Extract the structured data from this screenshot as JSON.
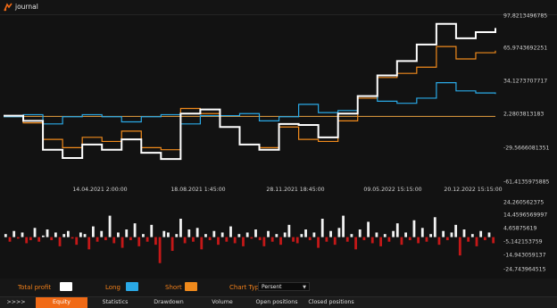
{
  "window": {
    "title": "journal"
  },
  "chart": {
    "y_labels_top": [
      "97,8213496785",
      "65,9743692251",
      "34,1273707717",
      "2,2803813183",
      "-29,5666081351",
      "-61,4135975885"
    ],
    "x_labels": [
      "14.04.2021 2:00:00",
      "18.08.2021 1:45:00",
      "28.11.2021 18:45:00",
      "09.05.2022 15:15:00",
      "20.12.2022 15:15:00"
    ],
    "y_labels_bottom": [
      "24,260562375",
      "14,4596569997",
      "4,65875619",
      "-5,142153759",
      "-14,943059137",
      "-24,743964515"
    ],
    "colors": {
      "total": "#ffffff",
      "long": "#2aa9e6",
      "short": "#f08a1c",
      "zero_line": "#e8a040",
      "bar_pos": "#f2f2f2",
      "bar_neg": "#c41818"
    }
  },
  "chart_data": [
    {
      "type": "line",
      "title": "",
      "ylim": [
        -61.4135975885,
        97.8213496785
      ],
      "x_ticks": [
        "14.04.2021 2:00:00",
        "18.08.2021 1:45:00",
        "28.11.2021 18:45:00",
        "09.05.2022 15:15:00",
        "20.12.2022 15:15:00"
      ],
      "reference_line": 2.2803813183,
      "x": [
        0,
        4,
        8,
        12,
        16,
        20,
        24,
        28,
        32,
        36,
        40,
        44,
        48,
        52,
        56,
        60,
        64,
        68,
        72,
        76,
        80,
        84,
        88,
        92,
        96,
        100
      ],
      "series": [
        {
          "name": "Total profit",
          "values": [
            3,
            -2,
            -30,
            -38,
            -25,
            -30,
            -20,
            -33,
            -39,
            5,
            9,
            -8,
            -25,
            -30,
            -5,
            -6,
            -18,
            5,
            22,
            42,
            56,
            72,
            92,
            78,
            84,
            88
          ]
        },
        {
          "name": "Long",
          "values": [
            2,
            4,
            -5,
            2,
            4,
            2,
            -3,
            2,
            4,
            -5,
            3,
            3,
            5,
            -2,
            2,
            14,
            6,
            8,
            22,
            17,
            15,
            20,
            35,
            27,
            25,
            24
          ]
        },
        {
          "name": "Short",
          "values": [
            2,
            -4,
            -20,
            -28,
            -18,
            -22,
            -12,
            -28,
            -30,
            10,
            5,
            -8,
            -25,
            -28,
            -8,
            -20,
            -22,
            -2,
            20,
            40,
            44,
            50,
            70,
            58,
            64,
            66
          ]
        }
      ]
    },
    {
      "type": "bar",
      "ylim": [
        -24.743964515,
        24.260562375
      ],
      "series": [
        {
          "values": [
            2,
            -3,
            4,
            -1,
            3,
            -4,
            -2,
            6,
            -3,
            1,
            5,
            -2,
            3,
            -6,
            2,
            4,
            -1,
            -5,
            3,
            2,
            -8,
            7,
            -3,
            4,
            -2,
            14,
            -4,
            3,
            -7,
            5,
            -2,
            9,
            -6,
            2,
            -3,
            8,
            -5,
            -17,
            4,
            3,
            -9,
            2,
            12,
            -4,
            5,
            -3,
            6,
            -8,
            2,
            -2,
            4,
            -5,
            3,
            -3,
            7,
            -4,
            2,
            -6,
            3,
            -1,
            5,
            -2,
            -6,
            4,
            -3,
            2,
            -5,
            3,
            8,
            -3,
            -4,
            2,
            5,
            -2,
            3,
            -7,
            12,
            -3,
            4,
            -5,
            6,
            14,
            -3,
            2,
            -8,
            5,
            -2,
            10,
            -4,
            3,
            -6,
            2,
            -3,
            4,
            9,
            -5,
            3,
            -2,
            11,
            -4,
            6,
            -3,
            2,
            13,
            -5,
            4,
            -2,
            3,
            8,
            -12,
            5,
            -3,
            2,
            -6,
            4,
            -2,
            3,
            -4
          ]
        }
      ]
    }
  ],
  "controls": {
    "total_label": "Total profit",
    "long_label": "Long",
    "short_label": "Short",
    "chart_type_label": "Chart Type",
    "chart_type_value": "Persent"
  },
  "tabs": [
    {
      "label": ">>>>"
    },
    {
      "label": "Equity",
      "active": true
    },
    {
      "label": "Statistics"
    },
    {
      "label": "Drawdown"
    },
    {
      "label": "Volume"
    },
    {
      "label": "Open positions"
    },
    {
      "label": "Closed positions"
    }
  ]
}
